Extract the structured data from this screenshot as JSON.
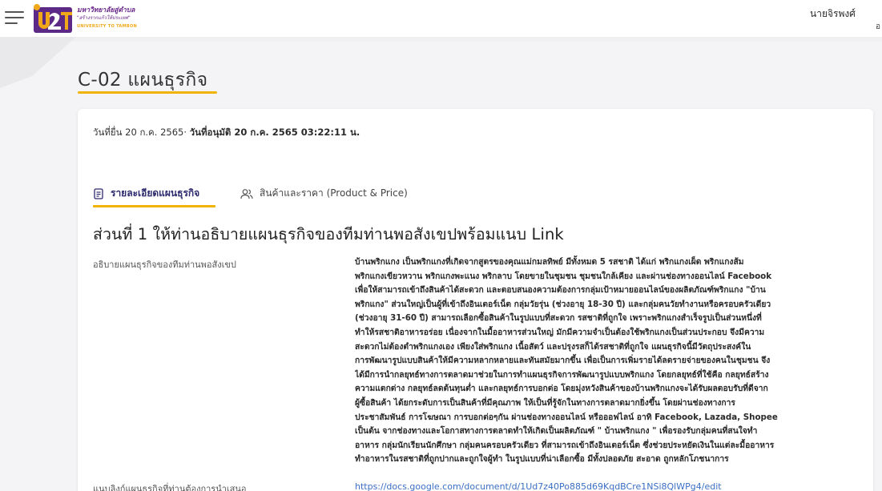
{
  "header": {
    "logo": {
      "letters": "U2T",
      "line1": "มหาวิทยาลัยสู่ตำบล",
      "line2": "\"สร้างรากแก้วให้ประเทศ\"",
      "line3": "UNIVERSITY TO TAMBON"
    },
    "user_name": "นายจิรพงศ์",
    "user_sub": "อ"
  },
  "page": {
    "title": "C-02 แผนธุรกิจ",
    "dates_prefix": "วันที่ยื่น 20 ก.ค. 2565",
    "dates_bold": "วันที่อนุมัติ 20 ก.ค. 2565 03:22:11 น."
  },
  "tabs": [
    {
      "label": "รายละเอียดแผนธุรกิจ",
      "icon": "document-icon",
      "active": true
    },
    {
      "label": "สินค้าและราคา (Product & Price)",
      "icon": "users-icon",
      "active": false
    }
  ],
  "section": {
    "heading": "ส่วนที่ 1 ให้ท่านอธิบายแผนธุรกิจของทีมท่านพอสังเขปพร้อมแนบ Link",
    "desc_label": "อธิบายแผนธุรกิจของทีมท่านพอสังเขป",
    "desc_lines": [
      "บ้านพริกแกง เป็นพริกแกงที่เกิดจากสูตรของคุณแม่กมลทิพย์ มีทั้งหมด 5 รสชาติ ได้แก่ พริกแกงเผ็ด พริกแกงส้ม",
      "พริกแกงเขียวหวาน พริกแกงพะแนง พริกลาบ โดยขายในชุมชน ชุมชนใกล้เคียง และผ่านช่องทางออนไลน์ Facebook",
      "เพื่อให้สามารถเข้าถึงสินค้าได้สะดวก และตอบสนองความต้องการกลุ่มเป้าหมายออนไลน์ของผลิตภัณฑ์พริกแกง \"บ้าน",
      "พริกแกง\" ส่วนใหญ่เป็นผู้ที่เข้าถึงอินเตอร์เน็ต กลุ่มวัยรุ่น (ช่วงอายุ 18-30 ปี) และกลุ่มคนวัยทำงานหรือครอบครัวเดียว",
      "(ช่วงอายุ 31-60 ปี) สามารถเลือกซื้อสินค้าในรูปแบบที่สะดวก รสชาติที่ถูกใจ เพราะพริกแกงสำเร็จรูปเป็นส่วนหนึ่งที่",
      "ทำให้รสชาติอาหารอร่อย เนื่องจากในมื้ออาหารส่วนใหญ่ มักมีความจำเป็นต้องใช้พริกแกงเป็นส่วนประกอบ จึงมีความ",
      "สะดวกไม่ต้องตำพริกแกงเอง เพียงใส่พริกแกง เนื้อสัตว์ และปรุงรสก็ได้รสชาติที่ถูกใจ แผนธุรกิจนี้มีวัตถุประสงค์ใน",
      "การพัฒนารูปแบบสินค้าให้มีความหลากหลายและทันสมัยมากขึ้น เพื่อเป็นการเพิ่มรายได้ลดรายจ่ายของคนในชุมชน จึง",
      "ได้มีการนำกลยุทธ์ทางการตลาดมาช่วยในการทำแผนธุรกิจการพัฒนารูปแบบพริกแกง โดยกลยุทธ์ที่ใช้คือ กลยุทธ์สร้าง",
      "ความแตกต่าง กลยุทธ์ลดต้นทุนต่ำ และกลยุทธ์การบอกต่อ โดยมุ่งหวังสินค้าของบ้านพริกแกงจะได้รับผลตอบรับที่ดีจาก",
      "ผู้ซื้อสินค้า ได้ยกระดับการเป็นสินค้าที่มีคุณภาพ ให้เป็นที่รู้จักในทางการตลาดมากยิ่งขึ้น โดยผ่านช่องทางการ",
      "ประชาสัมพันธ์ การโฆษณา การบอกต่อๆกัน ผ่านช่องทางออนไลน์ หรือออฟไลน์ อาทิ Facebook, Lazada, Shopee",
      "เป็นต้น จากช่องทางและโอกาสทางการตลาดทำให้เกิดเป็นผลิตภัณฑ์ \" บ้านพริกแกง \" เพื่อรองรับกลุ่มคนที่สนใจทำ",
      "อาหาร กลุ่มนักเรียนนักศึกษา กลุ่มคนครอบครัวเดียว ที่สามารถเข้าถึงอินเตอร์เน็ต ซึ่งช่วยประหยัดเงินในแต่ละมื้ออาหาร",
      "ทำอาหารในรสชาติที่ถูกปากและถูกใจผู้ทำ ในรูปแบบที่น่าเลือกซื้อ มีทั้งปลอดภัย สะอาด ถูกหลักโภชนาการ"
    ],
    "link_label": "แนบลิงก์แผนธุรกิจที่ท่านต้องการนำเสนอ",
    "link_value": "https://docs.google.com/document/d/1Ud7z40Po885d69KqdBCre1NSi8QlWPg4/edit"
  },
  "colors": {
    "accent": "#f0b400",
    "tab_active": "#2e2a6e",
    "link": "#3b6fc4"
  }
}
